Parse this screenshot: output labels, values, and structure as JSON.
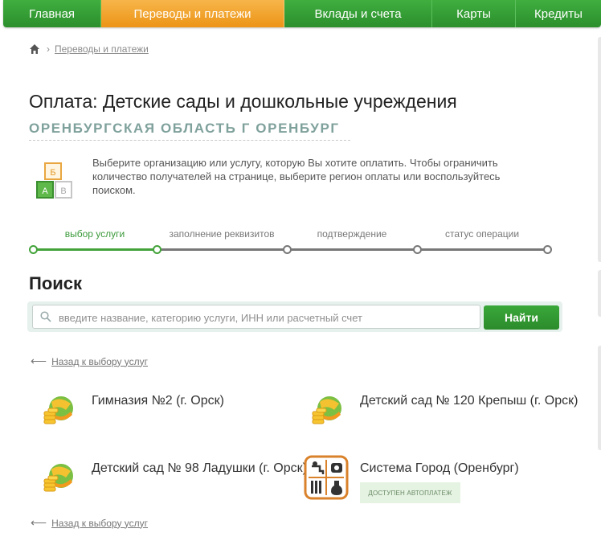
{
  "nav": {
    "items": [
      {
        "label": "Главная"
      },
      {
        "label": "Переводы и платежи"
      },
      {
        "label": "Вклады и счета"
      },
      {
        "label": "Карты"
      },
      {
        "label": "Кредиты"
      }
    ]
  },
  "breadcrumb": {
    "link": "Переводы и платежи"
  },
  "page": {
    "title": "Оплата: Детские сады и дошкольные учреждения",
    "region": "ОРЕНБУРГСКАЯ ОБЛАСТЬ Г ОРЕНБУРГ",
    "intro": "Выберите организацию или услугу, которую Вы хотите оплатить. Чтобы ограничить количество получателей на странице, выберите регион оплаты или воспользуйтесь поиском.",
    "intro_icon_letters": [
      "Б",
      "А",
      "В"
    ]
  },
  "steps": [
    {
      "label": "выбор услуги",
      "active": true
    },
    {
      "label": "заполнение реквизитов",
      "active": false
    },
    {
      "label": "подтверждение",
      "active": false
    },
    {
      "label": "статус операции",
      "active": false
    }
  ],
  "search": {
    "title": "Поиск",
    "placeholder": "введите название, категорию услуги, ИНН или расчетный счет",
    "button": "Найти"
  },
  "back_link": "Назад к выбору услуг",
  "providers": [
    {
      "name": "Гимназия №2 (г. Орск)",
      "icon": "coins-globe-icon"
    },
    {
      "name": "Детский сад № 120 Крепыш (г. Орск)",
      "icon": "coins-globe-icon"
    },
    {
      "name": "Детский сад № 98 Ладушки (г. Орск)",
      "icon": "coins-globe-icon"
    },
    {
      "name": "Система Город (Оренбург)",
      "icon": "utilities-icon",
      "badge": "ДОСТУПЕН АВТОПЛАТЕЖ"
    }
  ],
  "colors": {
    "nav_green": "#2c8f2c",
    "nav_active_orange": "#ec9416",
    "link_green": "#3d8b35",
    "region_teal": "#7fa19c"
  }
}
